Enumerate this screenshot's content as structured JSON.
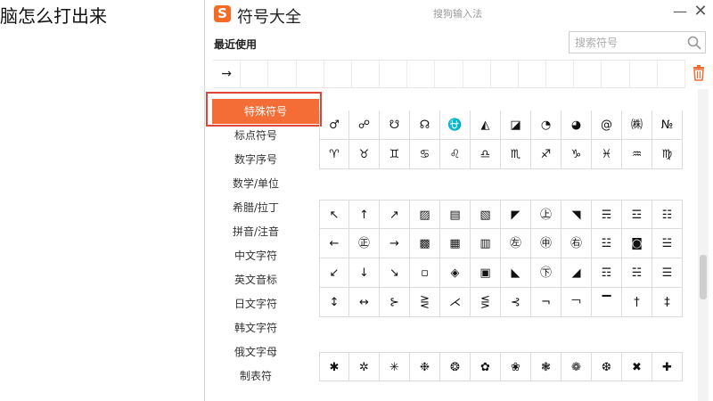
{
  "background": {
    "text": "脑怎么打出来"
  },
  "dialog": {
    "logo": "S",
    "title": "符号大全",
    "subtitle": "搜狗输入法",
    "minimize": "—",
    "close": "✕",
    "accent_color": "#f56d36"
  },
  "recent": {
    "label": "最近使用",
    "items": [
      "→",
      "",
      "",
      "",
      "",
      "",
      "",
      "",
      "",
      "",
      "",
      "",
      "",
      "",
      "",
      "",
      ""
    ]
  },
  "search": {
    "placeholder": "搜索符号"
  },
  "sidebar": {
    "items": [
      "特殊符号",
      "标点符号",
      "数字序号",
      "数学/单位",
      "希腊/拉丁",
      "拼音/注音",
      "中文字符",
      "英文音标",
      "日文字符",
      "韩文字符",
      "俄文字母",
      "制表符"
    ],
    "active_index": 0
  },
  "symbols": {
    "group1": [
      "♂",
      "☍",
      "☋",
      "☊",
      "⛎",
      "◭",
      "◪",
      "◔",
      "◕",
      "@",
      "㈱",
      "№",
      "♈",
      "♉",
      "♊",
      "♋",
      "♌",
      "♎",
      "♏",
      "♐",
      "♑",
      "♓",
      "♒",
      "♍"
    ],
    "group2": [
      "↖",
      "↑",
      "↗",
      "▨",
      "▤",
      "▧",
      "◤",
      "㊤",
      "◥",
      "☴",
      "☲",
      "☷",
      "←",
      "㊣",
      "→",
      "▩",
      "▦",
      "▥",
      "㊧",
      "㊥",
      "㊨",
      "☳",
      "◙",
      "☱",
      "↙",
      "↓",
      "↘",
      "▫",
      "◈",
      "▣",
      "◣",
      "㊦",
      "◢",
      "☶",
      "☵",
      "☰",
      "↕",
      "↔",
      "⊱",
      "⋛",
      "⋌",
      "⋚",
      "⊰",
      "¬",
      "￢",
      "▔",
      "†",
      "‡"
    ],
    "group3": [
      "✱",
      "✲",
      "✳",
      "❉",
      "❂",
      "✿",
      "❀",
      "❃",
      "❁",
      "❆",
      "✖",
      "✚"
    ]
  }
}
